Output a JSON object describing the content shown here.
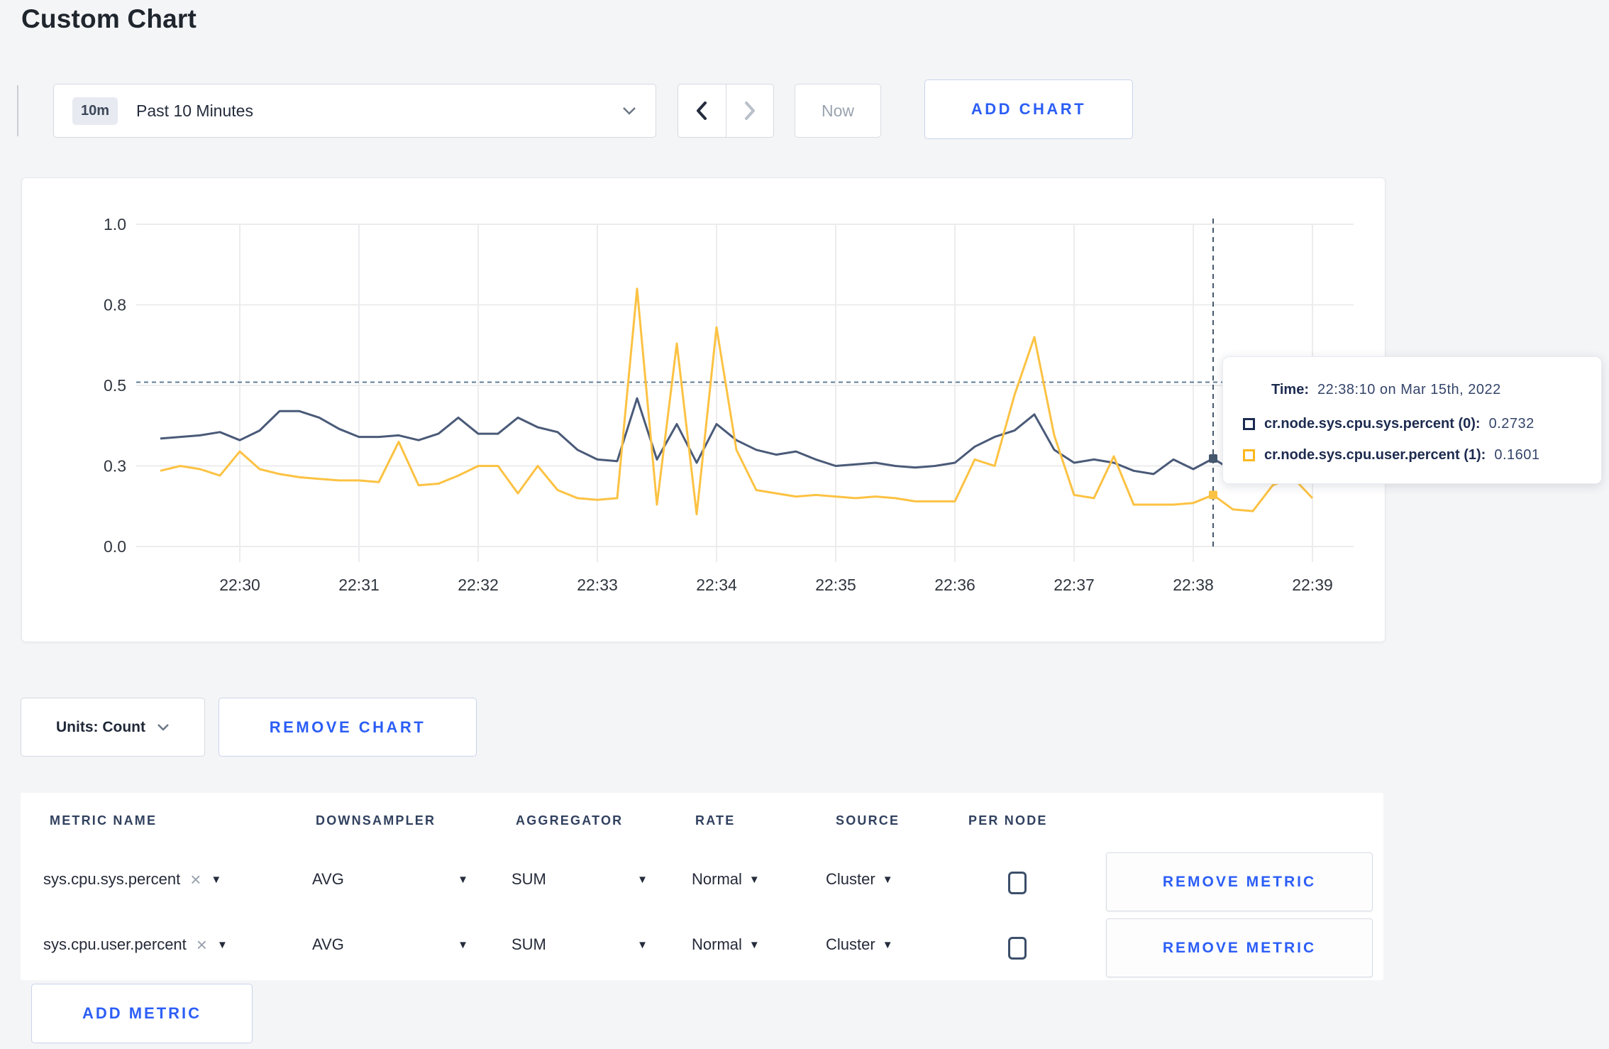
{
  "page": {
    "title": "Custom Chart"
  },
  "toolbar": {
    "time_range": {
      "badge": "10m",
      "label": "Past 10 Minutes"
    },
    "now_label": "Now",
    "add_chart_label": "ADD CHART"
  },
  "chart_data": {
    "type": "line",
    "x_axis": {
      "unit": "seconds from 22:30:00, Mar 15th 2022",
      "ticks": [
        {
          "sec": 0,
          "label": "22:30"
        },
        {
          "sec": 60,
          "label": "22:31"
        },
        {
          "sec": 120,
          "label": "22:32"
        },
        {
          "sec": 180,
          "label": "22:33"
        },
        {
          "sec": 240,
          "label": "22:34"
        },
        {
          "sec": 300,
          "label": "22:35"
        },
        {
          "sec": 360,
          "label": "22:36"
        },
        {
          "sec": 420,
          "label": "22:37"
        },
        {
          "sec": 480,
          "label": "22:38"
        },
        {
          "sec": 540,
          "label": "22:39"
        }
      ]
    },
    "y_axis": {
      "range": [
        0,
        1
      ],
      "ticks": [
        {
          "v": 0,
          "label": "0.0"
        },
        {
          "v": 0.25,
          "label": "0.3"
        },
        {
          "v": 0.5,
          "label": "0.5"
        },
        {
          "v": 0.75,
          "label": "0.8"
        },
        {
          "v": 1,
          "label": "1.0"
        }
      ]
    },
    "grid": true,
    "threshold_dashed_line_v": 0.51,
    "crosshair_sec": 490,
    "series": [
      {
        "name": "cr.node.sys.cpu.sys.percent",
        "color": "#4a5a78",
        "hover_value": 0.2732,
        "points": [
          [
            -40,
            0.335
          ],
          [
            -30,
            0.34
          ],
          [
            -20,
            0.345
          ],
          [
            -10,
            0.355
          ],
          [
            0,
            0.33
          ],
          [
            10,
            0.36
          ],
          [
            20,
            0.42
          ],
          [
            30,
            0.42
          ],
          [
            40,
            0.4
          ],
          [
            50,
            0.365
          ],
          [
            60,
            0.34
          ],
          [
            70,
            0.34
          ],
          [
            80,
            0.345
          ],
          [
            90,
            0.33
          ],
          [
            100,
            0.35
          ],
          [
            110,
            0.4
          ],
          [
            120,
            0.35
          ],
          [
            130,
            0.35
          ],
          [
            140,
            0.4
          ],
          [
            150,
            0.37
          ],
          [
            160,
            0.355
          ],
          [
            170,
            0.3
          ],
          [
            180,
            0.27
          ],
          [
            190,
            0.265
          ],
          [
            200,
            0.46
          ],
          [
            210,
            0.27
          ],
          [
            220,
            0.38
          ],
          [
            230,
            0.26
          ],
          [
            240,
            0.38
          ],
          [
            250,
            0.33
          ],
          [
            260,
            0.3
          ],
          [
            270,
            0.285
          ],
          [
            280,
            0.295
          ],
          [
            290,
            0.27
          ],
          [
            300,
            0.25
          ],
          [
            310,
            0.255
          ],
          [
            320,
            0.26
          ],
          [
            330,
            0.25
          ],
          [
            340,
            0.245
          ],
          [
            350,
            0.25
          ],
          [
            360,
            0.26
          ],
          [
            370,
            0.31
          ],
          [
            380,
            0.34
          ],
          [
            390,
            0.36
          ],
          [
            400,
            0.41
          ],
          [
            410,
            0.3
          ],
          [
            420,
            0.26
          ],
          [
            430,
            0.27
          ],
          [
            440,
            0.26
          ],
          [
            450,
            0.235
          ],
          [
            460,
            0.225
          ],
          [
            470,
            0.27
          ],
          [
            480,
            0.24
          ],
          [
            490,
            0.2732
          ],
          [
            500,
            0.235
          ],
          [
            510,
            0.24
          ],
          [
            520,
            0.25
          ],
          [
            530,
            0.25
          ],
          [
            540,
            0.25
          ],
          [
            550,
            0.26
          ]
        ]
      },
      {
        "name": "cr.node.sys.cpu.user.percent",
        "color": "#fcc243",
        "hover_value": 0.1601,
        "points": [
          [
            -40,
            0.235
          ],
          [
            -30,
            0.25
          ],
          [
            -20,
            0.24
          ],
          [
            -10,
            0.22
          ],
          [
            0,
            0.295
          ],
          [
            10,
            0.24
          ],
          [
            20,
            0.225
          ],
          [
            30,
            0.215
          ],
          [
            40,
            0.21
          ],
          [
            50,
            0.205
          ],
          [
            60,
            0.205
          ],
          [
            70,
            0.2
          ],
          [
            80,
            0.325
          ],
          [
            90,
            0.19
          ],
          [
            100,
            0.195
          ],
          [
            110,
            0.22
          ],
          [
            120,
            0.25
          ],
          [
            130,
            0.25
          ],
          [
            140,
            0.165
          ],
          [
            150,
            0.25
          ],
          [
            160,
            0.175
          ],
          [
            170,
            0.15
          ],
          [
            180,
            0.145
          ],
          [
            190,
            0.15
          ],
          [
            200,
            0.8
          ],
          [
            210,
            0.13
          ],
          [
            220,
            0.63
          ],
          [
            230,
            0.1
          ],
          [
            240,
            0.68
          ],
          [
            250,
            0.3
          ],
          [
            260,
            0.175
          ],
          [
            270,
            0.165
          ],
          [
            280,
            0.155
          ],
          [
            290,
            0.16
          ],
          [
            300,
            0.155
          ],
          [
            310,
            0.15
          ],
          [
            320,
            0.155
          ],
          [
            330,
            0.15
          ],
          [
            340,
            0.14
          ],
          [
            350,
            0.14
          ],
          [
            360,
            0.14
          ],
          [
            370,
            0.27
          ],
          [
            380,
            0.25
          ],
          [
            390,
            0.47
          ],
          [
            400,
            0.65
          ],
          [
            410,
            0.345
          ],
          [
            420,
            0.16
          ],
          [
            430,
            0.15
          ],
          [
            440,
            0.28
          ],
          [
            450,
            0.13
          ],
          [
            460,
            0.13
          ],
          [
            470,
            0.13
          ],
          [
            480,
            0.135
          ],
          [
            490,
            0.1601
          ],
          [
            500,
            0.115
          ],
          [
            510,
            0.11
          ],
          [
            520,
            0.19
          ],
          [
            530,
            0.215
          ],
          [
            540,
            0.15
          ]
        ]
      }
    ]
  },
  "tooltip": {
    "time_label": "Time:",
    "time_value": "22:38:10 on Mar 15th, 2022",
    "rows": [
      {
        "name": "cr.node.sys.cpu.sys.percent (0):",
        "value": "0.2732",
        "swatch_color": "#1c2c52"
      },
      {
        "name": "cr.node.sys.cpu.user.percent (1):",
        "value": "0.1601",
        "swatch_color": "#fdb81e"
      }
    ]
  },
  "chart_footer": {
    "units_label": "Units: Count",
    "remove_chart_label": "REMOVE CHART"
  },
  "metrics_table": {
    "columns": [
      "METRIC NAME",
      "DOWNSAMPLER",
      "AGGREGATOR",
      "RATE",
      "SOURCE",
      "PER NODE"
    ],
    "rows": [
      {
        "metric_name": "sys.cpu.sys.percent",
        "downsampler": "AVG",
        "aggregator": "SUM",
        "rate": "Normal",
        "source": "Cluster",
        "per_node_checked": false
      },
      {
        "metric_name": "sys.cpu.user.percent",
        "downsampler": "AVG",
        "aggregator": "SUM",
        "rate": "Normal",
        "source": "Cluster",
        "per_node_checked": false
      }
    ],
    "remove_metric_label": "REMOVE METRIC",
    "add_metric_label": "ADD METRIC"
  }
}
